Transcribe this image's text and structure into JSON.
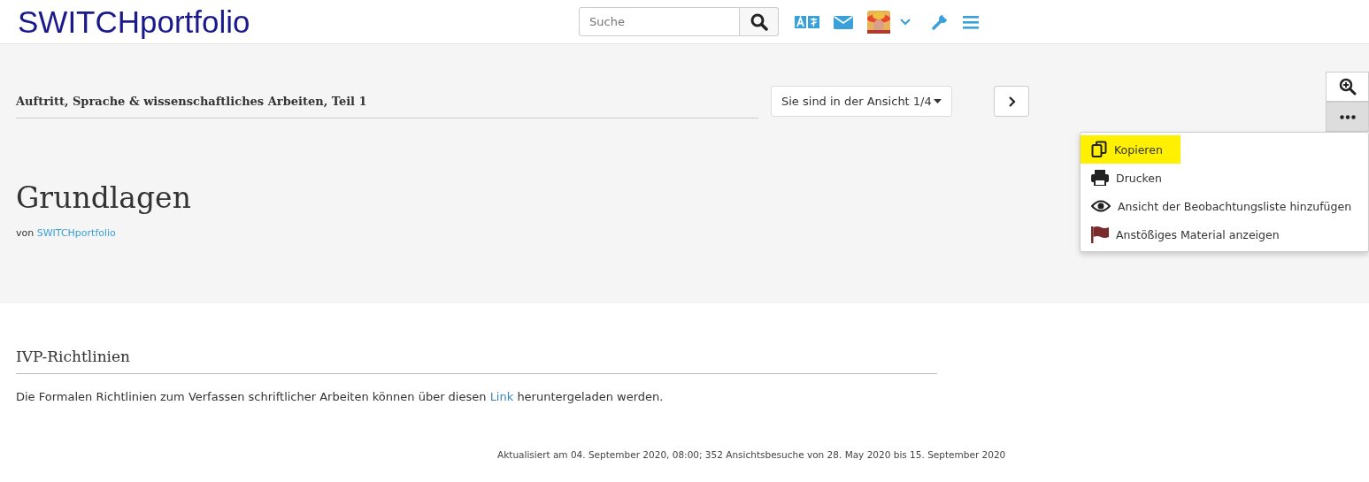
{
  "header": {
    "logo": "SWITCHportfolio",
    "search": {
      "placeholder": "Suche"
    }
  },
  "collection": {
    "title": "Auftritt, Sprache & wissenschaftliches Arbeiten, Teil 1",
    "view_select": "Sie sind in der Ansicht 1/4"
  },
  "page": {
    "title": "Grundlagen",
    "by": "von",
    "author": "SWITCHportfolio"
  },
  "more_menu": {
    "expanded": true,
    "items": [
      {
        "kind": "copy",
        "label": "Kopieren",
        "highlighted": true
      },
      {
        "kind": "print",
        "label": "Drucken",
        "highlighted": false
      },
      {
        "kind": "watch",
        "label": "Ansicht der Beobachtungsliste hinzufügen",
        "highlighted": false
      },
      {
        "kind": "report",
        "label": "Anstößiges Material anzeigen",
        "highlighted": false
      }
    ]
  },
  "block": {
    "title": "IVP-Richtlinien",
    "text_before": "Die Formalen Richtlinien zum Verfassen schriftlicher Arbeiten können über diesen",
    "link": "Link",
    "text_after": "heruntergeladen werden."
  },
  "footer": "Aktualisiert am 04. September 2020, 08:00; 352 Ansichtsbesuche von 28. May 2020 bis 15. September 2020"
}
